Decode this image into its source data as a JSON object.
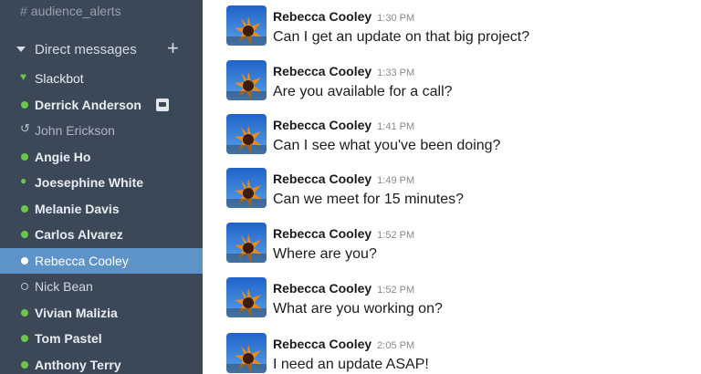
{
  "sidebar": {
    "channel": {
      "hash": "#",
      "name": "audience_alerts"
    },
    "dm_header": {
      "label": "Direct messages",
      "plus": "+"
    },
    "dms": [
      {
        "name": "Slackbot",
        "status": "heart",
        "icon": "heart-icon"
      },
      {
        "name": "Derrick Anderson",
        "status": "online",
        "icon": "online-dot-icon",
        "badge": true
      },
      {
        "name": "John Erickson",
        "status": "bot",
        "icon": "away-person-icon"
      },
      {
        "name": "Angie Ho",
        "status": "online",
        "icon": "online-dot-icon"
      },
      {
        "name": "Joesephine White",
        "status": "person",
        "icon": "online-person-icon"
      },
      {
        "name": "Melanie Davis",
        "status": "online",
        "icon": "online-dot-icon"
      },
      {
        "name": "Carlos Alvarez",
        "status": "online",
        "icon": "online-dot-icon"
      },
      {
        "name": "Rebecca Cooley",
        "status": "online",
        "icon": "online-dot-icon",
        "active": true
      },
      {
        "name": "Nick Bean",
        "status": "away",
        "icon": "offline-dot-icon"
      },
      {
        "name": "Vivian Malizia",
        "status": "online",
        "icon": "online-dot-icon"
      },
      {
        "name": "Tom Pastel",
        "status": "online",
        "icon": "online-dot-icon"
      },
      {
        "name": "Anthony Terry",
        "status": "online",
        "icon": "online-dot-icon"
      }
    ]
  },
  "messages": [
    {
      "author": "Rebecca Cooley",
      "time": "1:30 PM",
      "text": "Can I get an update on that big project?"
    },
    {
      "author": "Rebecca Cooley",
      "time": "1:33 PM",
      "text": "Are you available for a call?"
    },
    {
      "author": "Rebecca Cooley",
      "time": "1:41 PM",
      "text": "Can I see what you've been doing?"
    },
    {
      "author": "Rebecca Cooley",
      "time": "1:49 PM",
      "text": "Can we meet for 15 minutes?"
    },
    {
      "author": "Rebecca Cooley",
      "time": "1:52 PM",
      "text": "Where are you?"
    },
    {
      "author": "Rebecca Cooley",
      "time": "1:52 PM",
      "text": "What are you working on?"
    },
    {
      "author": "Rebecca Cooley",
      "time": "2:05 PM",
      "text": "I need an update ASAP!"
    }
  ],
  "colors": {
    "sidebar_bg": "#3a4858",
    "active_bg": "#5d93c9",
    "online": "#6ec54b"
  }
}
